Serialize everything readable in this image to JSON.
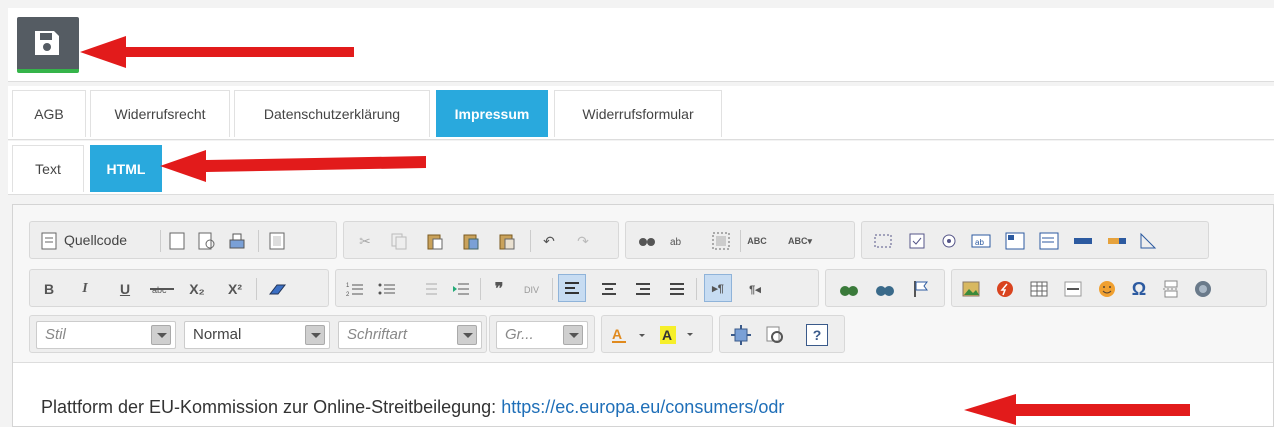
{
  "save_button": {
    "icon": "floppy-disk-icon"
  },
  "tabs_row1": [
    {
      "label": "AGB",
      "active": false
    },
    {
      "label": "Widerrufsrecht",
      "active": false
    },
    {
      "label": "Datenschutzerklärung",
      "active": false
    },
    {
      "label": "Impressum",
      "active": true
    },
    {
      "label": "Widerrufsformular",
      "active": false
    }
  ],
  "tabs_row2": [
    {
      "label": "Text",
      "active": false
    },
    {
      "label": "HTML",
      "active": true
    }
  ],
  "toolbar": {
    "source_label": "Quellcode",
    "style_placeholder": "Stil",
    "format_value": "Normal",
    "font_placeholder": "Schriftart",
    "size_placeholder": "Gr...",
    "bold": "B",
    "italic": "I",
    "underline": "U",
    "subscript": "X₂",
    "superscript": "X²",
    "quote": "❞",
    "omega": "Ω",
    "help": "?"
  },
  "content": {
    "text": "Plattform der EU-Kommission zur Online-Streitbeilegung: ",
    "link": "https://ec.europa.eu/consumers/odr"
  },
  "colors": {
    "accent": "#29a9dd",
    "save_bg": "#555c63",
    "save_underline": "#35b44a",
    "arrow": "#e21b1b",
    "link": "#1f6fb8"
  }
}
